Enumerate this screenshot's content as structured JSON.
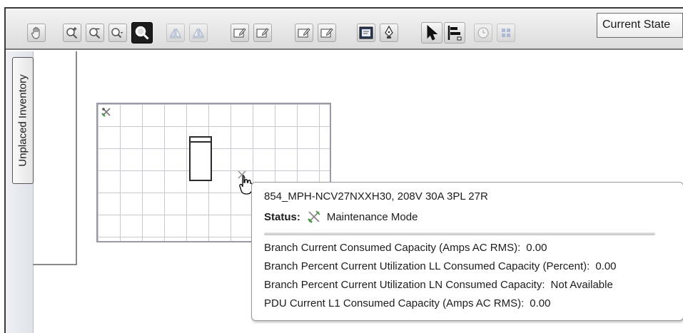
{
  "toolbar": {
    "tools": [
      {
        "name": "pan-tool",
        "icon": "hand-icon"
      },
      {
        "name": "zoom-in",
        "icon": "zoom-in-icon"
      },
      {
        "name": "zoom-out",
        "icon": "zoom-out-icon"
      },
      {
        "name": "zoom-menu",
        "icon": "zoom-dropdown-icon"
      },
      {
        "name": "zoom-fit",
        "icon": "magnifier-icon"
      },
      {
        "name": "flip-horizontal",
        "icon": "flip-h-icon"
      },
      {
        "name": "flip-vertical",
        "icon": "flip-v-icon"
      },
      {
        "name": "edit-1",
        "icon": "note-edit-icon"
      },
      {
        "name": "edit-2",
        "icon": "note-edit-icon"
      },
      {
        "name": "edit-3",
        "icon": "note-edit-icon"
      },
      {
        "name": "edit-4",
        "icon": "note-edit-icon"
      },
      {
        "name": "properties",
        "icon": "properties-icon"
      },
      {
        "name": "pen",
        "icon": "pen-icon"
      },
      {
        "name": "select",
        "icon": "arrow-cursor-icon"
      },
      {
        "name": "align",
        "icon": "align-icon"
      },
      {
        "name": "clock",
        "icon": "clock-icon"
      },
      {
        "name": "grid",
        "icon": "grid-icon"
      }
    ],
    "state_select": {
      "value": "Current State"
    }
  },
  "sidebar": {
    "tab_label": "Unplaced Inventory"
  },
  "tooltip": {
    "title": "854_MPH-NCV27NXXH30, 208V 30A 3PL 27R",
    "status_label": "Status:",
    "status_value": "Maintenance Mode",
    "rows": [
      {
        "label": "Branch Current Consumed Capacity (Amps AC RMS):",
        "value": "0.00"
      },
      {
        "label": "Branch Percent Current Utilization LL Consumed Capacity (Percent):",
        "value": "0.00"
      },
      {
        "label": "Branch Percent Current Utilization LN Consumed Capacity:",
        "value": "Not Available"
      },
      {
        "label": "PDU Current L1 Consumed Capacity (Amps AC RMS):",
        "value": "0.00"
      }
    ]
  },
  "colors": {
    "maintenance_icon": "#3a9a3a",
    "maintenance_icon_secondary": "#8a8a8a"
  }
}
